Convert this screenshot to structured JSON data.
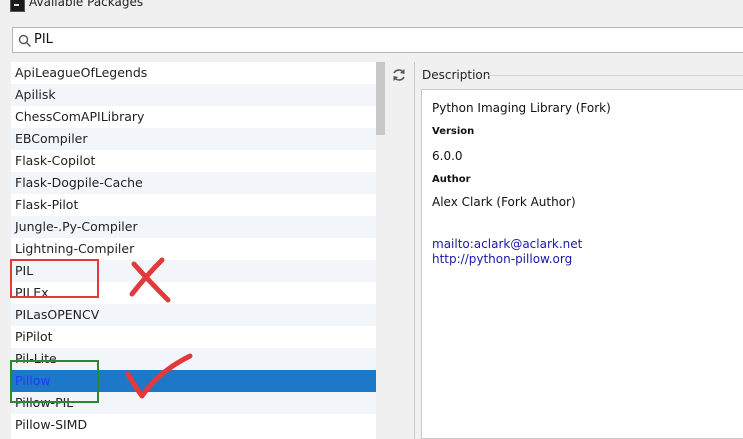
{
  "window": {
    "title": "Available Packages"
  },
  "search": {
    "value": "PIL"
  },
  "packages": [
    "ApiLeagueOfLegends",
    "Apilisk",
    "ChessComAPILibrary",
    "EBCompiler",
    "Flask-Copilot",
    "Flask-Dogpile-Cache",
    "Flask-Pilot",
    "Jungle-.Py-Compiler",
    "Lightning-Compiler",
    "PIL",
    "PILEx",
    "PILasOPENCV",
    "PiPilot",
    "Pil-Lite",
    "Pillow",
    "Pillow-PIL",
    "Pillow-SIMD"
  ],
  "selected_package": "Pillow",
  "description": {
    "legend": "Description",
    "summary": "Python Imaging Library (Fork)",
    "version_label": "Version",
    "version": "6.0.0",
    "author_label": "Author",
    "author": "Alex Clark (Fork Author)",
    "links": [
      "mailto:aclark@aclark.net",
      "http://python-pillow.org"
    ]
  },
  "annotations": {
    "wrong_mark": "cross",
    "correct_mark": "check",
    "colors": {
      "wrong": "#e23a3a",
      "correct": "#2b8a2b"
    }
  },
  "icons": {
    "search": "search-icon",
    "refresh": "refresh-icon",
    "app": "app-icon"
  },
  "colors": {
    "selection": "#1e78c8",
    "link": "#1a1aa6"
  }
}
